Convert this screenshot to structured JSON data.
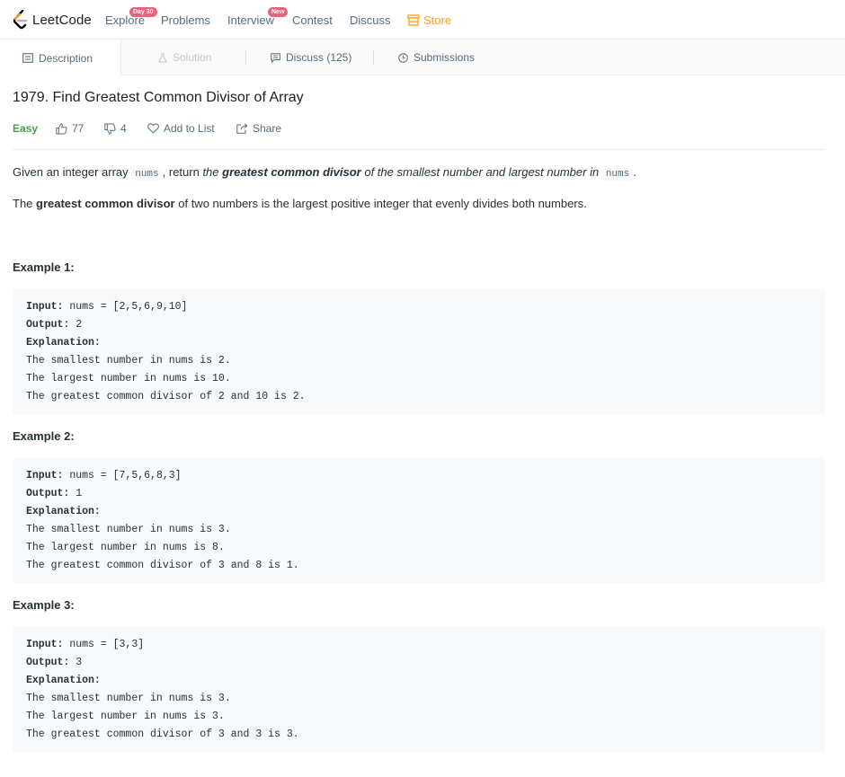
{
  "nav": {
    "logo_text": "LeetCode",
    "explore": "Explore",
    "explore_badge": "Day 30",
    "problems": "Problems",
    "interview": "Interview",
    "interview_badge": "New",
    "contest": "Contest",
    "discuss": "Discuss",
    "store": "Store"
  },
  "tabs": {
    "description": "Description",
    "solution": "Solution",
    "discuss": "Discuss (125)",
    "submissions": "Submissions"
  },
  "problem": {
    "title": "1979. Find Greatest Common Divisor of Array",
    "difficulty": "Easy",
    "likes": "77",
    "dislikes": "4",
    "add_to_list": "Add to List",
    "share": "Share"
  },
  "description": {
    "p1_a": "Given an integer array ",
    "p1_code1": "nums",
    "p1_b": ", return ",
    "p1_c": "the ",
    "p1_d": "greatest common divisor",
    "p1_e": " of the smallest number and largest number in ",
    "p1_code2": "nums",
    "p1_f": ".",
    "p2_a": "The ",
    "p2_b": "greatest common divisor",
    "p2_c": " of two numbers is the largest positive integer that evenly divides both numbers."
  },
  "examples": [
    {
      "heading": "Example 1:",
      "input_label": "Input:",
      "input": " nums = [2,5,6,9,10]",
      "output_label": "Output:",
      "output": " 2",
      "explanation_label": "Explanation:",
      "lines": [
        "The smallest number in nums is 2.",
        "The largest number in nums is 10.",
        "The greatest common divisor of 2 and 10 is 2."
      ]
    },
    {
      "heading": "Example 2:",
      "input_label": "Input:",
      "input": " nums = [7,5,6,8,3]",
      "output_label": "Output:",
      "output": " 1",
      "explanation_label": "Explanation:",
      "lines": [
        "The smallest number in nums is 3.",
        "The largest number in nums is 8.",
        "The greatest common divisor of 3 and 8 is 1."
      ]
    },
    {
      "heading": "Example 3:",
      "input_label": "Input:",
      "input": " nums = [3,3]",
      "output_label": "Output:",
      "output": " 3",
      "explanation_label": "Explanation:",
      "lines": [
        "The smallest number in nums is 3.",
        "The largest number in nums is 3.",
        "The greatest common divisor of 3 and 3 is 3."
      ]
    }
  ],
  "colors": {
    "accent": "#ffa116",
    "easy": "#43a047",
    "badge": "#e9627c"
  }
}
